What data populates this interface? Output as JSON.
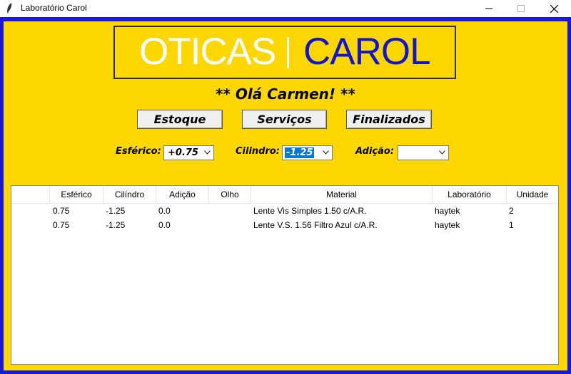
{
  "window": {
    "title": "Laboratório Carol"
  },
  "logo": {
    "left": "OTICAS",
    "right": "CAROL"
  },
  "greeting": "** Olá Carmen! **",
  "buttons": {
    "estoque": "Estoque",
    "servicos": "Serviços",
    "finalizados": "Finalizados"
  },
  "filters": {
    "esferico": {
      "label": "Esférico:",
      "value": "+0.75"
    },
    "cilindro": {
      "label": "Cilindro:",
      "value": "-1.25"
    },
    "adicao": {
      "label": "Adição:",
      "value": ""
    }
  },
  "table": {
    "columns": [
      "Esférico",
      "Cilíndro",
      "Adição",
      "Olho",
      "Material",
      "Laboratório",
      "Unidade"
    ],
    "rows": [
      {
        "esferico": "0.75",
        "cilindro": "-1.25",
        "adicao": "0.0",
        "olho": "",
        "material": "Lente Vis Simples 1.50 c/A.R.",
        "laboratorio": "haytek",
        "unidade": "2"
      },
      {
        "esferico": "0.75",
        "cilindro": "-1.25",
        "adicao": "0.0",
        "olho": "",
        "material": "Lente V.S. 1.56 Filtro Azul c/A.R.",
        "laboratorio": "haytek",
        "unidade": "1"
      }
    ]
  },
  "colors": {
    "background": "#ffd700",
    "frame": "#1a1ad6",
    "logo_left": "#ffffff",
    "logo_right": "#1515c8",
    "selection": "#0078d7"
  }
}
